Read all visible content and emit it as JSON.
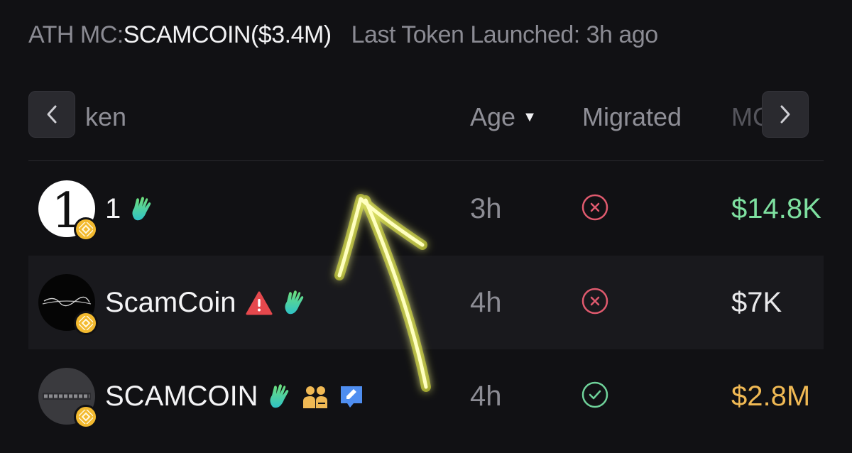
{
  "summary": {
    "ath_label": "ATH MC:",
    "ath_value": "SCAMCOIN($3.4M)",
    "last_launch": "Last Token Launched: 3h ago"
  },
  "table": {
    "headers": {
      "token": "ken",
      "age": "Age",
      "migrated": "Migrated",
      "mc": "MC"
    },
    "rows": [
      {
        "name": "1",
        "age": "3h",
        "migrated": false,
        "mc": "$14.8K",
        "mc_color": "#7ee0a0"
      },
      {
        "name": "ScamCoin",
        "age": "4h",
        "migrated": false,
        "mc": "$7K",
        "mc_color": "#e8e8ea"
      },
      {
        "name": "SCAMCOIN",
        "age": "4h",
        "migrated": true,
        "mc": "$2.8M",
        "mc_color": "#f0b954"
      }
    ]
  },
  "icons": {
    "row1": [
      "bnb-badge-icon",
      "waving-hand-icon"
    ],
    "row2": [
      "bnb-badge-icon",
      "warning-triangle-icon",
      "waving-hand-icon"
    ],
    "row3": [
      "bnb-badge-icon",
      "waving-hand-icon",
      "people-icon",
      "edit-note-icon"
    ]
  },
  "colors": {
    "not_migrated": "#e05a6e",
    "migrated": "#6fd29a",
    "bnb": "#f3ba2f",
    "annotation_arrow": "#f5f53a"
  }
}
